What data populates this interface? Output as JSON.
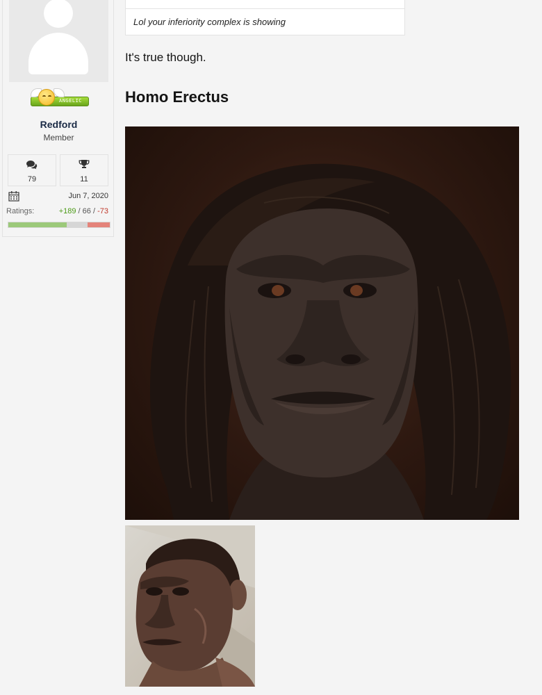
{
  "user": {
    "name": "Redford",
    "title": "Member",
    "badge_text": "ANGELIC",
    "messages": "79",
    "trophies": "11",
    "joined": "Jun 7, 2020",
    "ratings_label": "Ratings:",
    "ratings_positive": "+189",
    "ratings_neutral": "66",
    "ratings_negative": "-73",
    "separator": "/"
  },
  "quote": {
    "text": "Lol your inferiority complex is showing"
  },
  "post": {
    "text": "It's true though.",
    "heading": "Homo Erectus"
  },
  "colors": {
    "positive": "#4c9a17",
    "negative": "#c0392b",
    "name": "#1a2a45"
  },
  "icons": {
    "messages": "comments-icon",
    "trophies": "trophy-icon",
    "joined": "calendar-icon"
  }
}
